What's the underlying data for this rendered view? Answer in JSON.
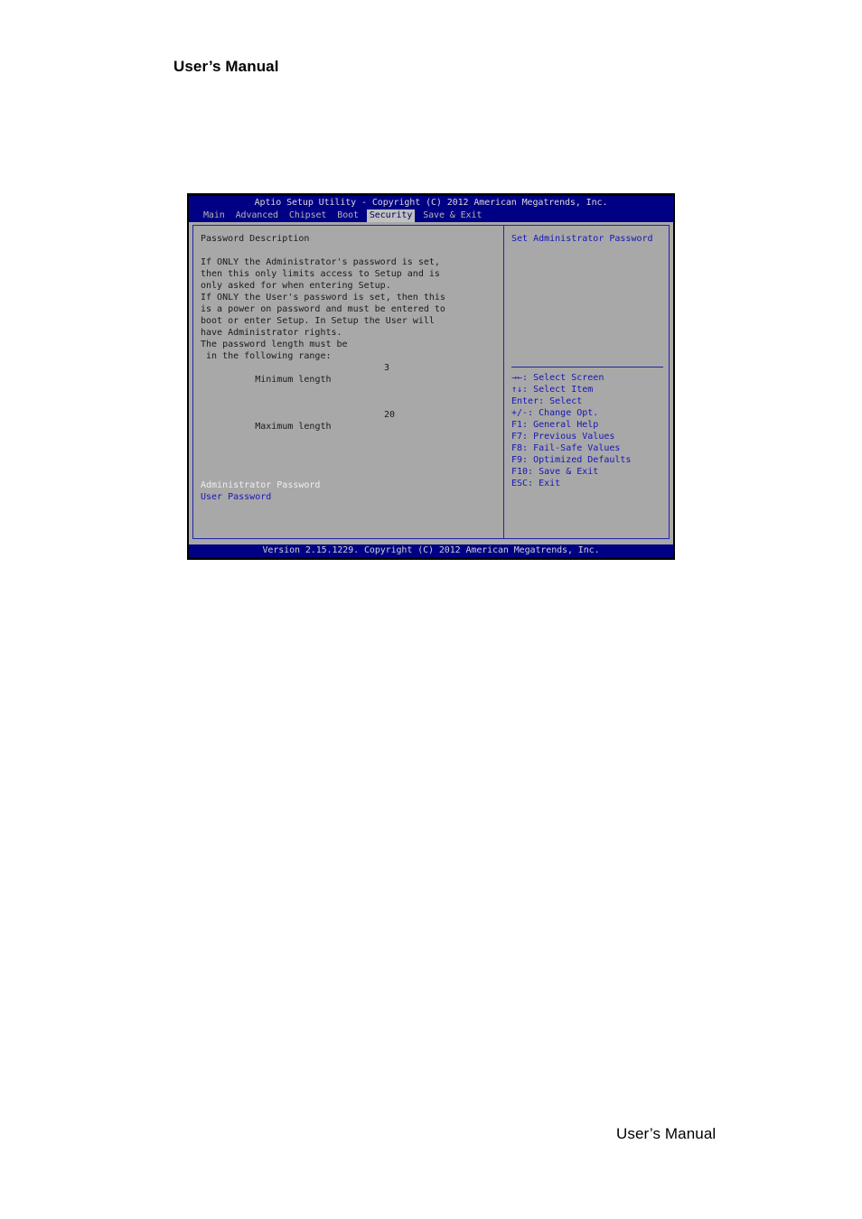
{
  "document": {
    "header_title": "User’s Manual",
    "footer_title": "User’s Manual"
  },
  "bios": {
    "title": "Aptio Setup Utility - Copyright (C) 2012 American Megatrends, Inc.",
    "footer": "Version 2.15.1229. Copyright (C) 2012 American Megatrends, Inc.",
    "menu_tabs": [
      {
        "label": "Main",
        "active": false
      },
      {
        "label": "Advanced",
        "active": false
      },
      {
        "label": "Chipset",
        "active": false
      },
      {
        "label": "Boot",
        "active": false
      },
      {
        "label": "Security",
        "active": true
      },
      {
        "label": "Save & Exit",
        "active": false
      }
    ],
    "left_pane": {
      "section_title": "Password Description",
      "description_lines": [
        "If ONLY the Administrator's password is set,",
        "then this only limits access to Setup and is",
        "only asked for when entering Setup.",
        "If ONLY the User's password is set, then this",
        "is a power on password and must be entered to",
        "boot or enter Setup. In Setup the User will",
        "have Administrator rights.",
        "The password length must be",
        " in the following range:"
      ],
      "length_rows": [
        {
          "label": "Minimum length",
          "value": "3"
        },
        {
          "label": "Maximum length",
          "value": "20"
        }
      ],
      "password_items": [
        {
          "label": "Administrator Password",
          "selected": true
        },
        {
          "label": "User Password",
          "selected": false
        }
      ]
    },
    "right_pane": {
      "help_text": "Set Administrator Password",
      "key_legend": [
        "→←: Select Screen",
        "↑↓: Select Item",
        "Enter: Select",
        "+/-: Change Opt.",
        "F1: General Help",
        "F7: Previous Values",
        "F8: Fail-Safe Values",
        "F9: Optimized Defaults",
        "F10: Save & Exit",
        "ESC: Exit"
      ]
    },
    "colors": {
      "bar_blue": "#000084",
      "text_blue": "#1616b4",
      "panel_gray": "#a8a8a8",
      "border_blue": "#2222a8",
      "active_tab_bg": "#c0c0c0"
    }
  }
}
